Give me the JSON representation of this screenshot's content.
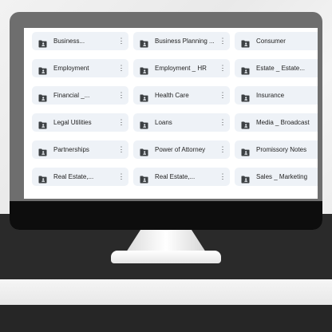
{
  "folders": [
    {
      "name": "Business...",
      "icon": "shared-folder-icon"
    },
    {
      "name": "Business Planning ...",
      "icon": "shared-folder-icon"
    },
    {
      "name": "Consumer",
      "icon": "shared-folder-icon"
    },
    {
      "name": "Employment",
      "icon": "shared-folder-icon"
    },
    {
      "name": "Employment _ HR",
      "icon": "shared-folder-icon"
    },
    {
      "name": "Estate _ Estate...",
      "icon": "shared-folder-icon"
    },
    {
      "name": "Financial _...",
      "icon": "shared-folder-icon"
    },
    {
      "name": "Health Care",
      "icon": "shared-folder-icon"
    },
    {
      "name": "Insurance",
      "icon": "shared-folder-icon"
    },
    {
      "name": "Legal Utilities",
      "icon": "shared-folder-icon"
    },
    {
      "name": "Loans",
      "icon": "shared-folder-icon"
    },
    {
      "name": "Media _ Broadcast",
      "icon": "shared-folder-icon"
    },
    {
      "name": "Partnerships",
      "icon": "shared-folder-icon"
    },
    {
      "name": "Power of Attorney",
      "icon": "shared-folder-icon"
    },
    {
      "name": "Promissory Notes",
      "icon": "shared-folder-icon"
    },
    {
      "name": "Real Estate,...",
      "icon": "shared-folder-icon"
    },
    {
      "name": "Real Estate,...",
      "icon": "shared-folder-icon"
    },
    {
      "name": "Sales _ Marketing",
      "icon": "shared-folder-icon"
    }
  ],
  "more_icon": "more-vert-icon",
  "colors": {
    "tile_background": "#eef2f7",
    "monitor_bezel": "#6e6e6e",
    "monitor_chin": "#0d0d0d",
    "desk": "#2a2a2a"
  }
}
